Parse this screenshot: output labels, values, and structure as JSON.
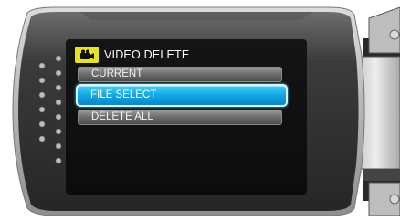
{
  "menu": {
    "title": "VIDEO DELETE",
    "mode_icon": "video-camera-icon",
    "items": [
      {
        "label": "CURRENT",
        "selected": false
      },
      {
        "label": "FILE SELECT",
        "selected": true
      },
      {
        "label": "DELETE ALL",
        "selected": false
      }
    ]
  },
  "colors": {
    "selection": "#13a5e2",
    "mode_badge": "#e6e22a",
    "screen": "#111111"
  }
}
